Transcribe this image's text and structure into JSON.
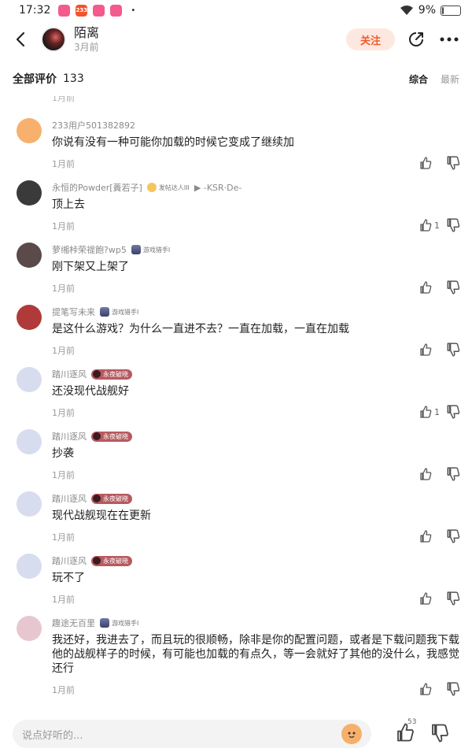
{
  "status_bar": {
    "time": "17:32",
    "app_icons": [
      {
        "label": "",
        "color": "#f45a8c"
      },
      {
        "label": "233",
        "color": "#f5532b"
      },
      {
        "label": "",
        "color": "#f45a8c"
      },
      {
        "label": "",
        "color": "#f45a8c"
      }
    ],
    "dot": "•",
    "battery": "9%",
    "battery_level": 0.09
  },
  "header": {
    "name": "陌离",
    "time": "3月前",
    "follow_label": "关注"
  },
  "subheader": {
    "all_label": "全部评价",
    "count": "133",
    "sort_active": "综合",
    "sort_inactive": "最新"
  },
  "prev_footer": "1月前",
  "comments": [
    {
      "name": "233用户501382892",
      "avatar": "orange-smiley-avatar",
      "text": "你说有没有一种可能你加载的时候它变成了继续加",
      "time": "1月前",
      "likes": ""
    },
    {
      "name": "永恒的Powder[蕢若子]",
      "badge": "发帖达人III",
      "extra": "▶ -KSR·De-",
      "avatar": "dark-character-avatar",
      "text": "顶上去",
      "time": "1月前",
      "likes": "1"
    },
    {
      "name": "萝缃桛荣禔飽?wp5",
      "badge": "游戏猎手I",
      "avatar": "dark-haired-girl-avatar",
      "text": "刚下架又上架了",
      "time": "1月前",
      "likes": ""
    },
    {
      "name": "提笔写未来",
      "badge": "游戏猎手I",
      "avatar": "red-character-avatar",
      "text": "是这什么游戏？为什么一直进不去？一直在加载，一直在加载",
      "time": "1月前",
      "likes": ""
    },
    {
      "name": "踏川逐风",
      "badge": "永夜破晓",
      "avatar": "white-haired-girl-avatar",
      "text": "还没现代战舰好",
      "time": "1月前",
      "likes": "1"
    },
    {
      "name": "踏川逐风",
      "badge": "永夜破晓",
      "avatar": "white-haired-girl-avatar",
      "text": "抄袭",
      "time": "1月前",
      "likes": ""
    },
    {
      "name": "踏川逐风",
      "badge": "永夜破晓",
      "avatar": "white-haired-girl-avatar",
      "text": "现代战舰现在在更新",
      "time": "1月前",
      "likes": ""
    },
    {
      "name": "踏川逐风",
      "badge": "永夜破晓",
      "avatar": "white-haired-girl-avatar",
      "text": "玩不了",
      "time": "1月前",
      "likes": ""
    },
    {
      "name": "趣途无百里",
      "badge": "游戏猎手I",
      "avatar": "pink-haired-girl-avatar",
      "text": "我还好，我进去了，而且玩的很顺畅，除非是你的配置问题，或者是下载问题我下载他的战舰样子的时候，有可能也加载的有点久，等一会就好了其他的没什么，我感觉还行",
      "time": "1月前",
      "likes": ""
    }
  ],
  "bottom_bar": {
    "placeholder": "说点好听的...",
    "like_count": "53"
  },
  "colors": {
    "accent": "#f25a2b",
    "follow_bg": "#fde8e0",
    "badge_red": "#b65a60"
  }
}
